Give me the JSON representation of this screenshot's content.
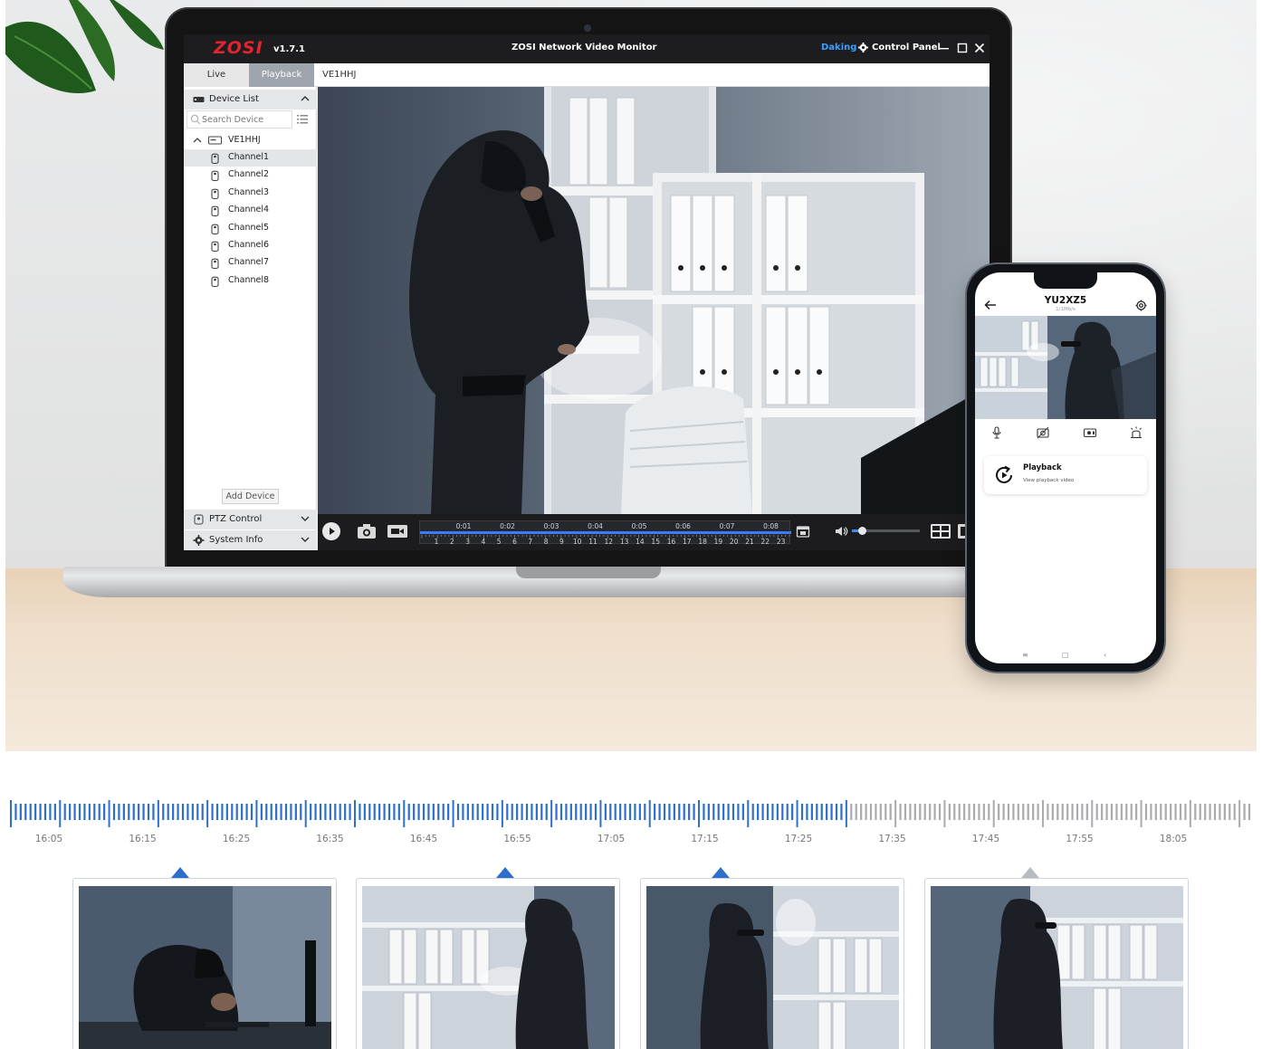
{
  "app": {
    "logo": "ZOSI",
    "version": "v1.7.1",
    "title": "ZOSI Network Video Monitor",
    "user": "Daking",
    "control_panel": "Control Panel",
    "accent_color": "#3aa0ff",
    "brand_color": "#e02430"
  },
  "tabs": [
    {
      "label": "Live",
      "active": false
    },
    {
      "label": "Playback",
      "active": true
    }
  ],
  "current_device": "VE1HHJ",
  "sidebar": {
    "device_list_label": "Device List",
    "search_placeholder": "Search Device",
    "root_device": "VE1HHJ",
    "channels": [
      "Channel1",
      "Channel2",
      "Channel3",
      "Channel4",
      "Channel5",
      "Channel6",
      "Channel7",
      "Channel8"
    ],
    "selected_channel": "Channel1",
    "add_device_label": "Add Device",
    "ptz_control_label": "PTZ Control",
    "system_info_label": "System Info"
  },
  "playback_bar": {
    "top_ticks": [
      "0:01",
      "0:02",
      "0:03",
      "0:04",
      "0:05",
      "0:06",
      "0:07",
      "0:08"
    ],
    "hour_ticks": [
      "1",
      "2",
      "3",
      "4",
      "5",
      "6",
      "7",
      "8",
      "9",
      "10",
      "11",
      "12",
      "13",
      "14",
      "15",
      "16",
      "17",
      "18",
      "19",
      "20",
      "21",
      "22",
      "23"
    ],
    "volume_level": 0.15
  },
  "phone": {
    "device_name": "YU2XZ5",
    "device_sub": "1/1Mb/s",
    "playback_title": "Playback",
    "playback_subtitle": "View playback video"
  },
  "timeline": {
    "labels": [
      "16:05",
      "16:15",
      "16:25",
      "16:35",
      "16:45",
      "16:55",
      "17:05",
      "17:15",
      "17:25",
      "17:35",
      "17:45",
      "17:55",
      "18:05"
    ],
    "recorded_fraction": 0.675,
    "active_color": "#2f6fcc",
    "inactive_color": "#a9abaf"
  },
  "thumbnails": [
    {
      "name": "clip-1",
      "marker_active": true
    },
    {
      "name": "clip-2",
      "marker_active": true
    },
    {
      "name": "clip-3",
      "marker_active": true
    },
    {
      "name": "clip-4",
      "marker_active": false
    }
  ]
}
